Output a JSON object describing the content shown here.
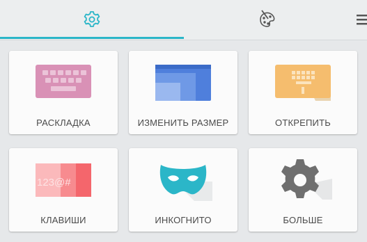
{
  "tabs": [
    {
      "icon": "gear-outline-icon",
      "active": true
    },
    {
      "icon": "palette-icon",
      "active": false
    },
    {
      "icon": "hamburger-menu-icon",
      "active": false
    }
  ],
  "colors": {
    "accent": "#2bb6c8",
    "layout_icon": "#d991b6",
    "resize_icon": "#4f7fdc",
    "undock_icon": "#f5bd6e",
    "keys_icon": "#f4666c",
    "incognito_icon": "#2bb6c8",
    "more_icon": "#6f6f6f"
  },
  "tiles": [
    {
      "label": "РАСКЛАДКА",
      "icon": "keyboard-layout-icon"
    },
    {
      "label": "ИЗМЕНИТЬ РАЗМЕР",
      "icon": "resize-icon"
    },
    {
      "label": "ОТКРЕПИТЬ",
      "icon": "undock-keyboard-icon"
    },
    {
      "label": "КЛАВИШИ",
      "icon": "keys-icon",
      "icon_text": "123@#"
    },
    {
      "label": "ИНКОГНИТО",
      "icon": "incognito-mask-icon"
    },
    {
      "label": "БОЛЬШЕ",
      "icon": "gear-icon"
    }
  ]
}
